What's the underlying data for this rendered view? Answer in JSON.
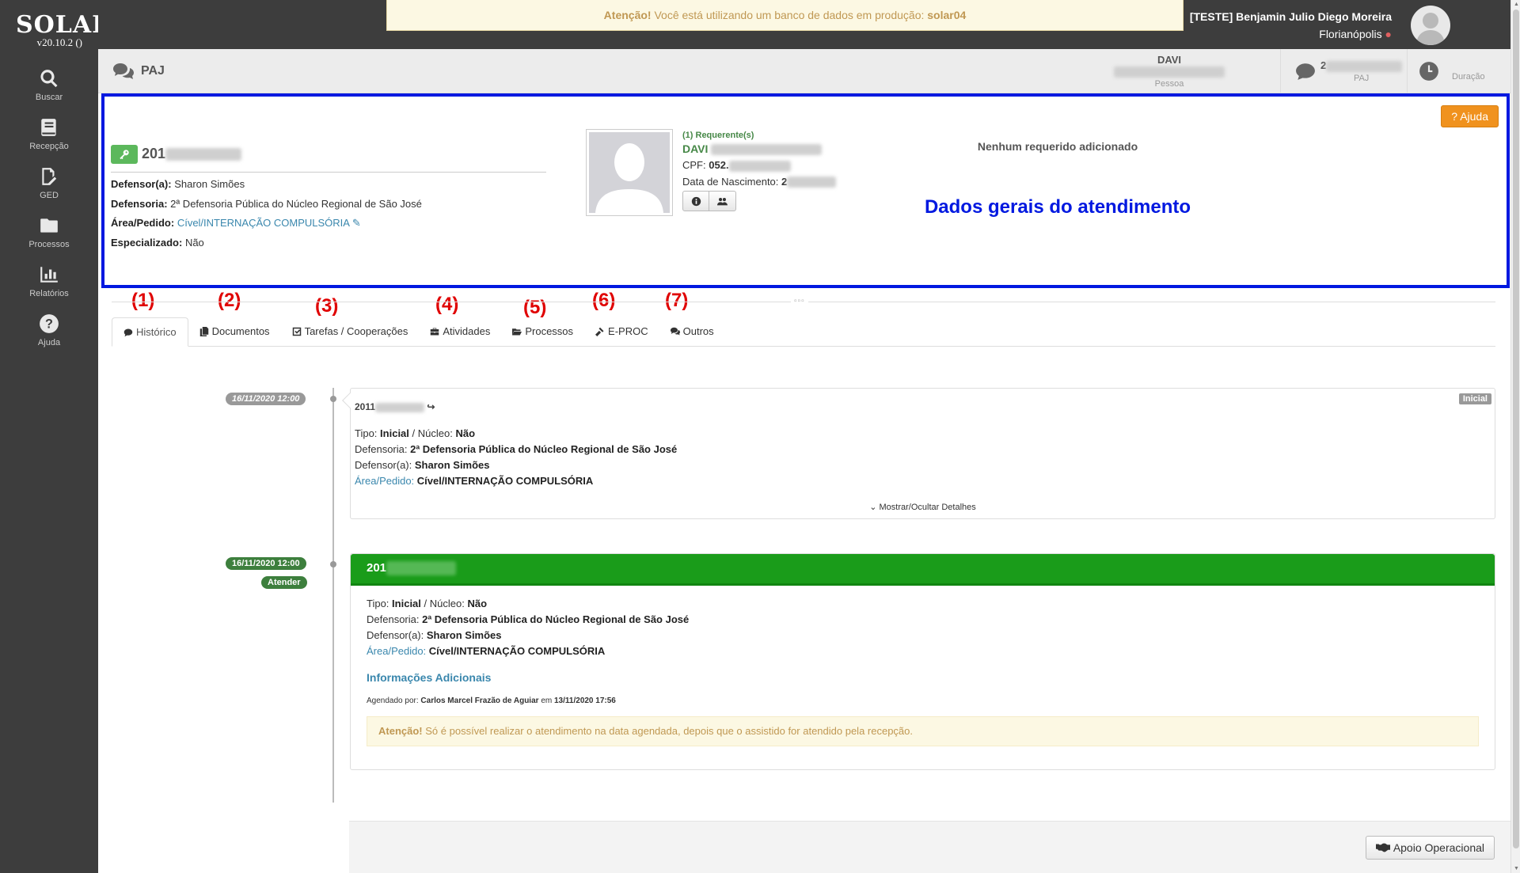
{
  "app": {
    "name": "SOLAR",
    "version": "v20.10.2 ()"
  },
  "sidebar": {
    "items": [
      {
        "label": "Buscar",
        "icon": "search-icon"
      },
      {
        "label": "Recepção",
        "icon": "book-icon"
      },
      {
        "label": "GED",
        "icon": "edit-document-icon"
      },
      {
        "label": "Processos",
        "icon": "folder-icon"
      },
      {
        "label": "Relatórios",
        "icon": "bar-chart-icon"
      },
      {
        "label": "Ajuda",
        "icon": "question-icon"
      }
    ]
  },
  "alert": {
    "prefix": "Atenção!",
    "text": "Você está utilizando um banco de dados em produção:",
    "db": "solar04"
  },
  "user": {
    "name": "[TESTE] Benjamin Julio Diego Moreira",
    "city": "Florianópolis"
  },
  "header": {
    "title": "PAJ",
    "pessoa": {
      "name": "DAVI",
      "label": "Pessoa"
    },
    "paj": {
      "value": "2",
      "label": "PAJ"
    },
    "duracao": {
      "label": "Duração"
    }
  },
  "general": {
    "ajuda_label": "Ajuda",
    "numero": "201",
    "defensor_label": "Defensor(a):",
    "defensor": "Sharon Simões",
    "defensoria_label": "Defensoria:",
    "defensoria": "2ª Defensoria Pública do Núcleo Regional de São José",
    "area_label": "Área/Pedido:",
    "area": "Cível/INTERNAÇÃO COMPULSÓRIA",
    "especializado_label": "Especializado:",
    "especializado": "Não",
    "requerentes_label": "(1) Requerente(s)",
    "requerente_nome": "DAVI",
    "cpf_label": "CPF:",
    "cpf": "052.",
    "nascimento_label": "Data de Nascimento:",
    "nascimento": "2",
    "nenhum_requerido": "Nenhum requerido adicionado",
    "annotation": "Dados gerais do atendimento"
  },
  "annotations": [
    "(1)",
    "(2)",
    "(3)",
    "(4)",
    "(5)",
    "(6)",
    "(7)"
  ],
  "tabs": [
    {
      "label": "Histórico",
      "icon": "comment-icon"
    },
    {
      "label": "Documentos",
      "icon": "documents-icon"
    },
    {
      "label": "Tarefas / Cooperações",
      "icon": "checkbox-icon"
    },
    {
      "label": "Atividades",
      "icon": "briefcase-icon"
    },
    {
      "label": "Processos",
      "icon": "folder-open-icon"
    },
    {
      "label": "E-PROC",
      "icon": "gavel-icon"
    },
    {
      "label": "Outros",
      "icon": "comments-icon"
    }
  ],
  "timeline": [
    {
      "date": "16/11/2020 12:00",
      "numero": "2011",
      "badge": "Inicial",
      "tipo_label": "Tipo:",
      "tipo": "Inicial",
      "nucleo_label": "/ Núcleo:",
      "nucleo": "Não",
      "defensoria_label": "Defensoria:",
      "defensoria": "2ª Defensoria Pública do Núcleo Regional de São José",
      "defensor_label": "Defensor(a):",
      "defensor": "Sharon Simões",
      "area_label": "Área/Pedido:",
      "area": "Cível/INTERNAÇÃO COMPULSÓRIA",
      "toggle_label": "Mostrar/Ocultar Detalhes"
    },
    {
      "date": "16/11/2020 12:00",
      "action": "Atender",
      "numero": "201",
      "tipo_label": "Tipo:",
      "tipo": "Inicial",
      "nucleo_label": "/ Núcleo:",
      "nucleo": "Não",
      "defensoria_label": "Defensoria:",
      "defensoria": "2ª Defensoria Pública do Núcleo Regional de São José",
      "defensor_label": "Defensor(a):",
      "defensor": "Sharon Simões",
      "area_label": "Área/Pedido:",
      "area": "Cível/INTERNAÇÃO COMPULSÓRIA",
      "info_title": "Informações Adicionais",
      "agendado_label": "Agendado por:",
      "agendado_por": "Carlos Marcel Frazão de Aguiar",
      "em_label": "em",
      "agendado_em": "13/11/2020 17:56",
      "warn_prefix": "Atenção!",
      "warn_text": "Só é possível realizar o atendimento na data agendada, depois que o assistido for atendido pela recepção."
    }
  ],
  "footer": {
    "apoio_label": "Apoio Operacional"
  },
  "colors": {
    "sidebar": "#3d3d3d",
    "annotation_blue": "#0018e0",
    "annotation_red": "#e00000",
    "success": "#1a9c1a",
    "warning": "#f0921e"
  }
}
